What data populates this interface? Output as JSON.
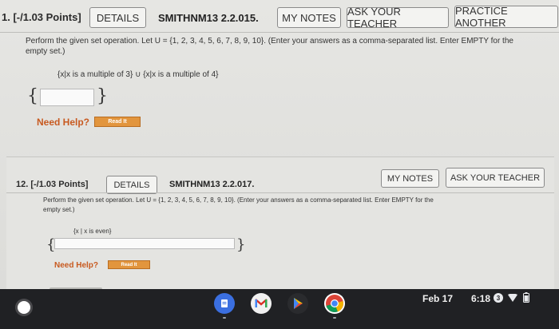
{
  "q11": {
    "number": "1. [-/1.03 Points]",
    "details": "DETAILS",
    "ref": "SMITHNM13 2.2.015.",
    "my_notes": "MY NOTES",
    "ask_teacher": "ASK YOUR TEACHER",
    "practice": "PRACTICE ANOTHER",
    "prompt_line1": "Perform the given set operation. Let U = {1, 2, 3, 4, 5, 6, 7, 8, 9, 10}. (Enter your answers as a comma-separated list. Enter EMPTY for the",
    "prompt_line2": "empty set.)",
    "expression": "{x|x is a multiple of 3} ∪ {x|x is a multiple of 4}",
    "brace_open": "{",
    "brace_close": "}",
    "answer": "",
    "need_help": "Need Help?",
    "read_it": "Read It"
  },
  "q12": {
    "number": "12. [-/1.03 Points]",
    "details": "DETAILS",
    "ref": "SMITHNM13 2.2.017.",
    "my_notes": "MY NOTES",
    "ask_teacher": "ASK YOUR TEACHER",
    "prompt_line1": "Perform the given set operation. Let U = {1, 2, 3, 4, 5, 6, 7, 8, 9, 10}. (Enter your answers as a comma-separated list. Enter EMPTY for the",
    "prompt_line2": "empty set.)",
    "expression": "{x | x is even}",
    "brace_open": "{",
    "brace_close": "}",
    "answer": "",
    "need_help": "Need Help?",
    "read_it": "Read It"
  },
  "taskbar": {
    "apps": [
      "docs-icon",
      "gmail-icon",
      "play-store-icon",
      "chrome-icon"
    ],
    "date": "Feb 17",
    "time": "6:18",
    "notification_count": "3"
  },
  "colors": {
    "need_help": "#c85a20",
    "read_it": "#e2953d",
    "taskbar": "#202124"
  }
}
